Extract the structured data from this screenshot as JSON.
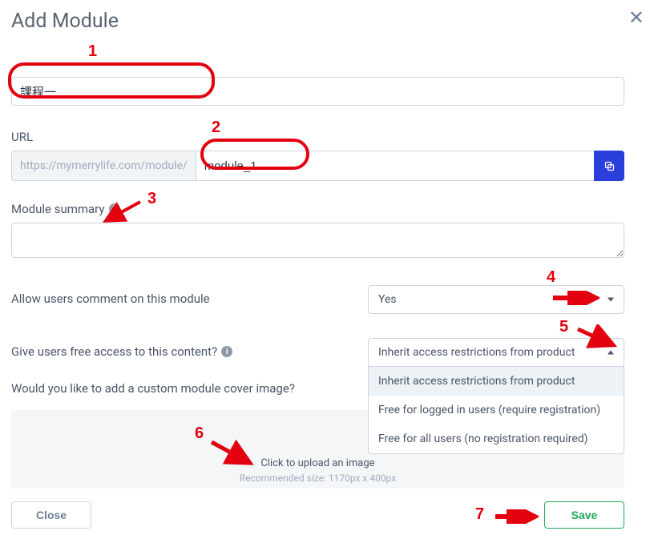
{
  "header": {
    "title": "Add Module"
  },
  "fields": {
    "name": {
      "value": "課程一"
    },
    "url": {
      "label": "URL",
      "prefix": "https://mymerrylife.com/module/",
      "value": "module_1"
    },
    "summary": {
      "label": "Module summary",
      "value": ""
    },
    "comments": {
      "label": "Allow users comment on this module",
      "value": "Yes"
    },
    "access": {
      "label": "Give users free access to this content?",
      "value": "Inherit access restrictions from product",
      "options": [
        "Inherit access restrictions from product",
        "Free for logged in users (require registration)",
        "Free for all users (no registration required)"
      ]
    },
    "cover": {
      "label": "Would you like to add a custom module cover image?",
      "click_text": "Click to upload an image",
      "size_text": "Recommended size: 1170px x 400px"
    }
  },
  "footer": {
    "close": "Close",
    "save": "Save"
  },
  "annotations": {
    "n1": "1",
    "n2": "2",
    "n3": "3",
    "n4": "4",
    "n5": "5",
    "n6": "6",
    "n7": "7"
  }
}
